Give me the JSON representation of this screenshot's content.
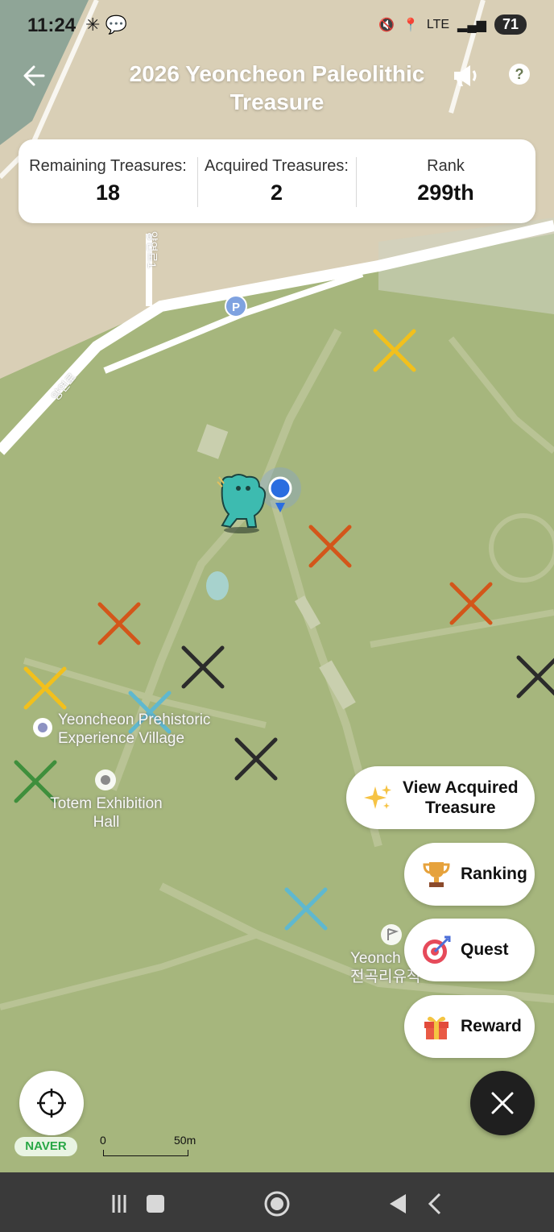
{
  "status_bar": {
    "time": "11:24",
    "battery": "71",
    "network": "LTE"
  },
  "header": {
    "title": "2026 Yeoncheon Paleolithic Treasure",
    "back_icon": "arrow-left-icon",
    "speaker_icon": "megaphone-icon",
    "help_label": "?"
  },
  "stats": {
    "remaining_label": "Remaining Treasures:",
    "remaining_value": "18",
    "acquired_label": "Acquired Treasures:",
    "acquired_value": "2",
    "rank_label": "Rank",
    "rank_value": "299th"
  },
  "map": {
    "places": {
      "village_line1": "Yeoncheon Prehistoric",
      "village_line2": "Experience Village",
      "totem_line1": "Totem Exhibition",
      "totem_line2": "Hall",
      "yeonch_line1": "Yeonch",
      "yeonch_line2": "전곡리유적"
    },
    "roads": {
      "road1": "양연로",
      "road2": "양연로1"
    },
    "marker_colors": {
      "yellow": "#f2c01c",
      "orange": "#d3561a",
      "black": "#2b2b2b",
      "cyan": "#5fb8cf",
      "green": "#3f8f3c"
    },
    "naver_logo": "NAVER",
    "scale_zero": "0",
    "scale_label": "50m"
  },
  "actions": {
    "view_acquired_line1": "View Acquired",
    "view_acquired_line2": "Treasure",
    "ranking": "Ranking",
    "quest": "Quest",
    "reward": "Reward"
  }
}
